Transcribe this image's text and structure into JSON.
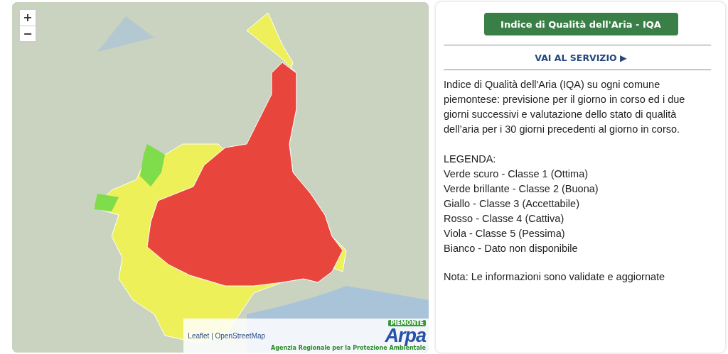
{
  "map": {
    "zoom_in": "+",
    "zoom_out": "−",
    "attribution": "Leaflet | OpenStreetMap",
    "logo": {
      "name": "Arpa",
      "region": "PIEMONTE",
      "subtitle": "Agenzia Regionale per la Protezione Ambientale"
    }
  },
  "panel": {
    "title_button": "Indice di Qualità dell'Aria - IQA",
    "service_link": "VAI AL SERVIZIO ▶",
    "description": "Indice di Qualità dell'Aria (IQA) su ogni comune piemontese: previsione per il giorno in corso ed i due giorni successivi e valutazione dello stato di qualità dell’aria per i 30 giorni precedenti al giorno in corso.",
    "legend_title": "LEGENDA:",
    "legend": [
      "Verde scuro - Classe 1 (Ottima)",
      "Verde brillante - Classe 2 (Buona)",
      "Giallo - Classe 3 (Accettabile)",
      "Rosso - Classe 4 (Cattiva)",
      "Viola - Classe 5 (Pessima)",
      "Bianco - Dato non disponibile"
    ],
    "note": "Nota: Le informazioni sono validate e aggiornate"
  }
}
